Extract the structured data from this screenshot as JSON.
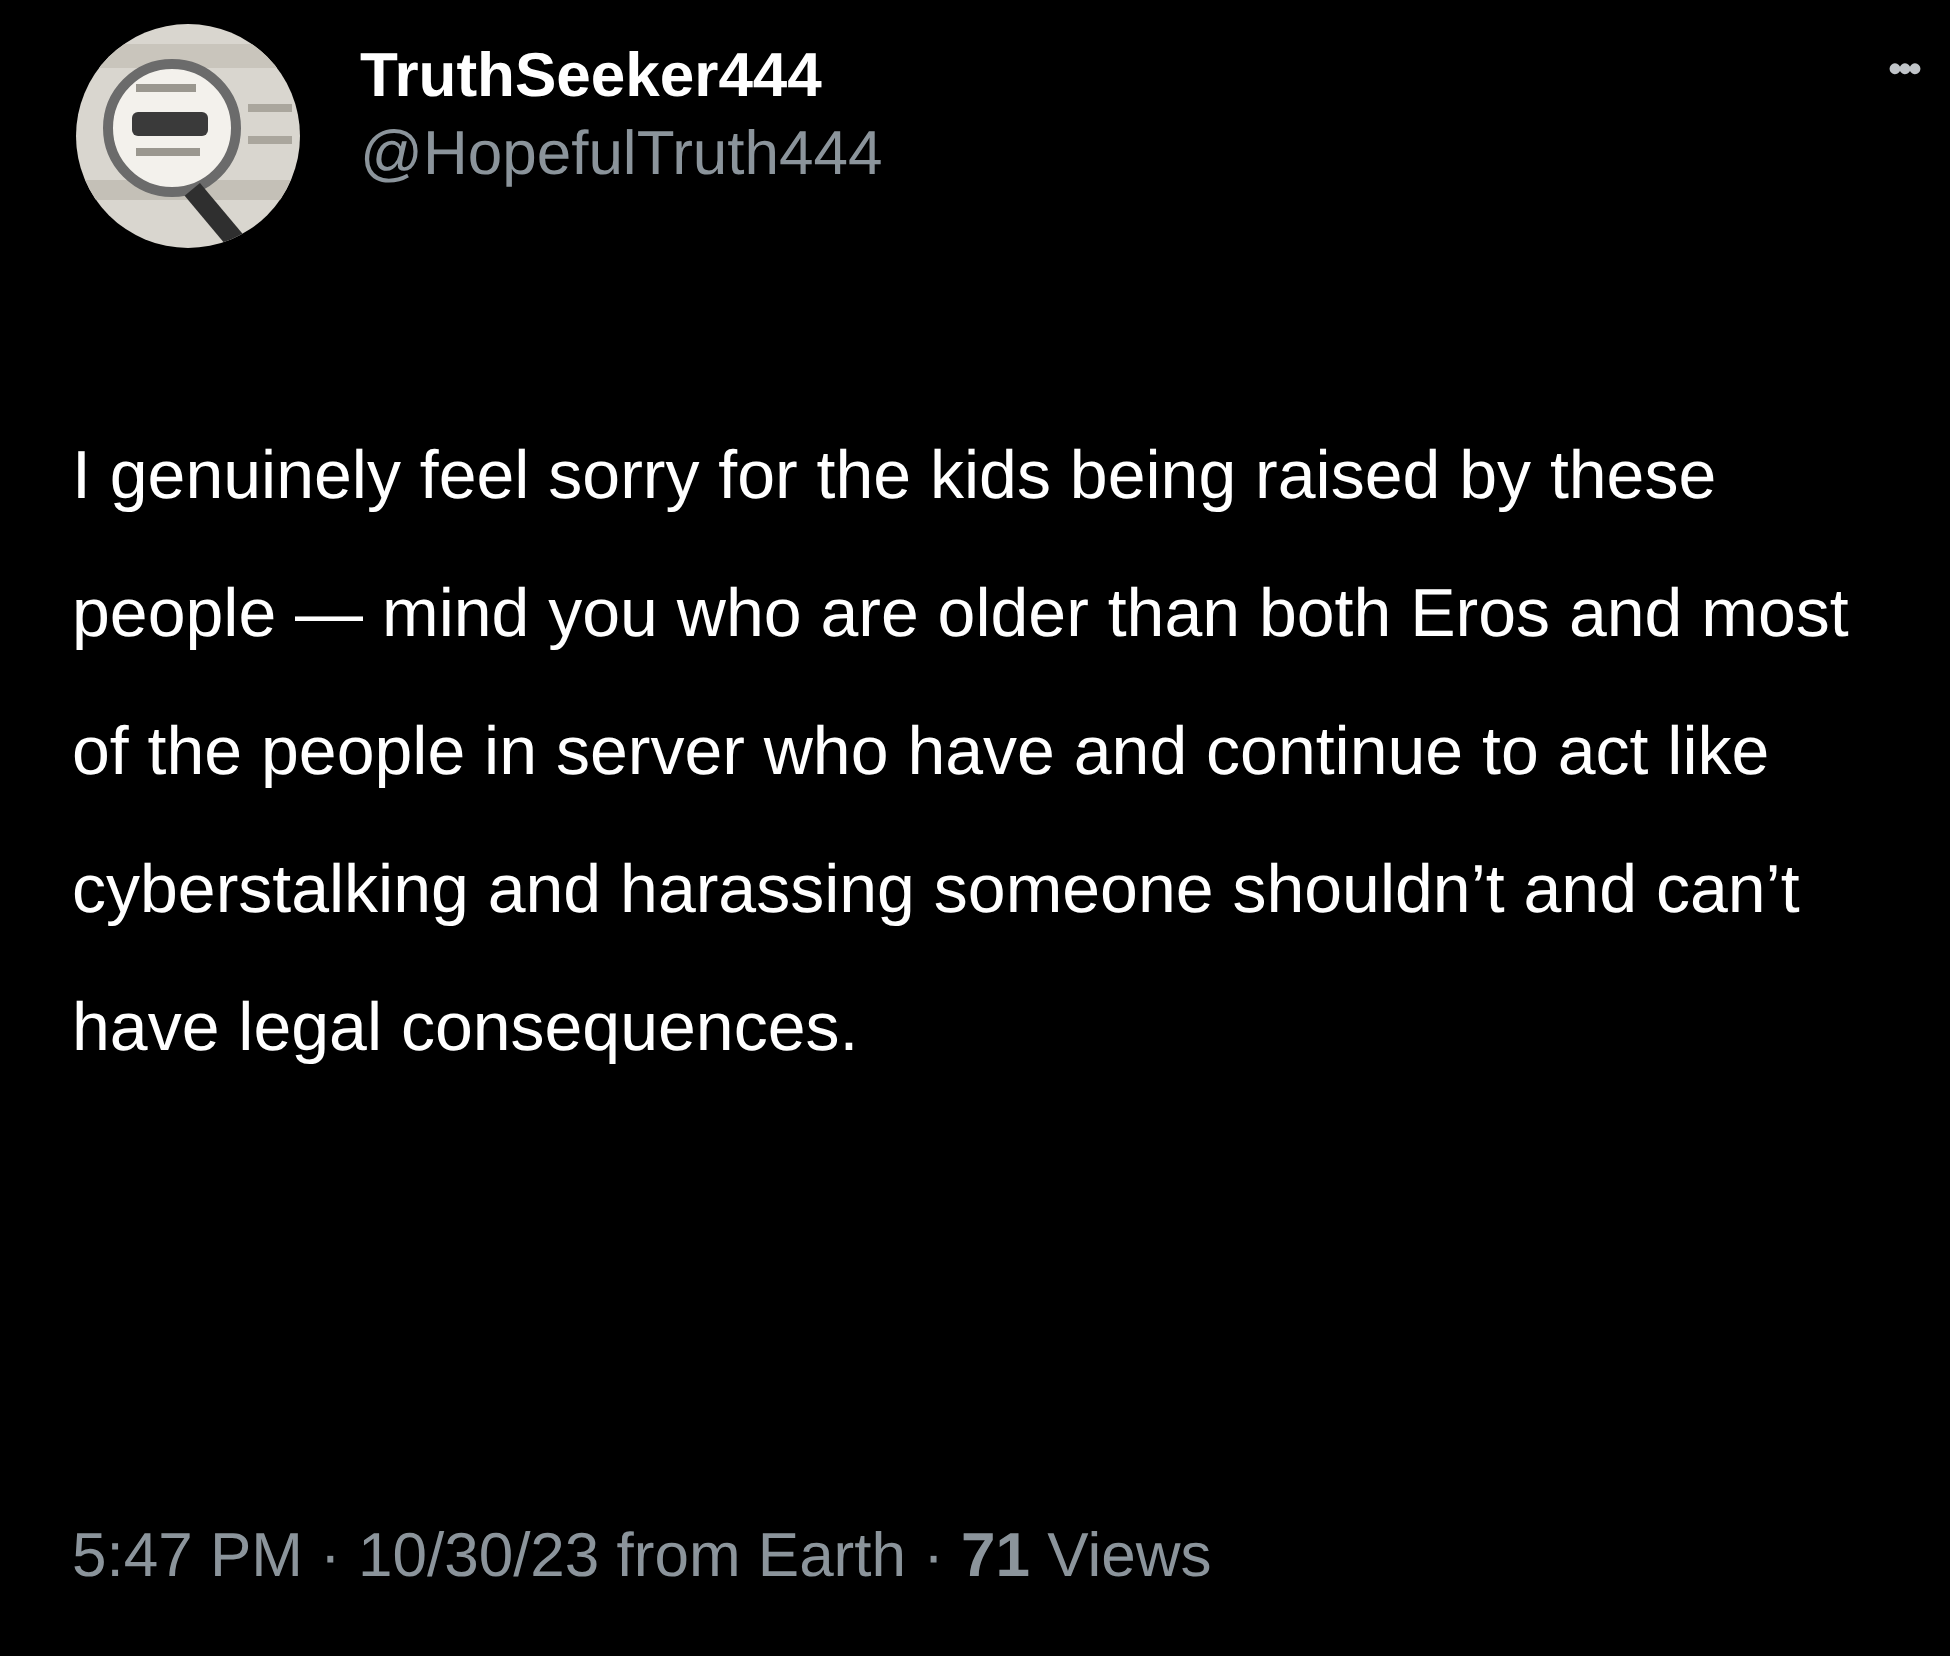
{
  "author": {
    "name": "TruthSeeker444",
    "handle": "@HopefulTruth444"
  },
  "more_button": "•••",
  "text": "I genuinely feel sorry for the kids being raised by these people — mind you who are older than both Eros and most of the people in server who have and continue to act like cyberstalking and harassing someone shouldn’t and can’t have legal consequences.",
  "meta": "5:47 PM · 10/30/23 from Earth · **71** Views"
}
